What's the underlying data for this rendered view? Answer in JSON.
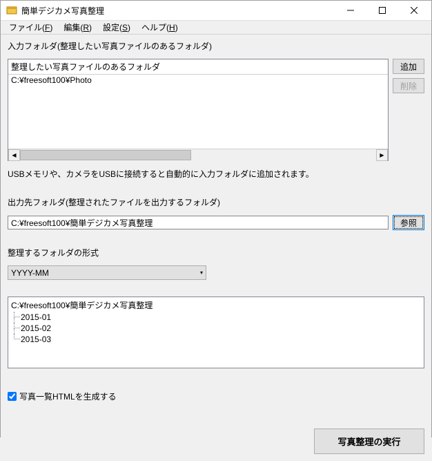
{
  "window": {
    "title": "簡単デジカメ写真整理"
  },
  "menubar": {
    "file": "ファイル(F)",
    "edit": "編集(R)",
    "settings": "設定(S)",
    "help": "ヘルプ(H)"
  },
  "input_section": {
    "label": "入力フォルダ(整理したい写真ファイルのあるフォルダ)",
    "header": "整理したい写真ファイルのあるフォルダ",
    "rows": [
      "C:¥freesoft100¥Photo"
    ],
    "add_btn": "追加",
    "delete_btn": "削除",
    "hint": "USBメモリや、カメラをUSBに接続すると自動的に入力フォルダに追加されます。"
  },
  "output_section": {
    "label": "出力先フォルダ(整理されたファイルを出力するフォルダ)",
    "path": "C:¥freesoft100¥簡単デジカメ写真整理",
    "browse_btn": "参照"
  },
  "format_section": {
    "label": "整理するフォルダの形式",
    "selected": "YYYY-MM"
  },
  "tree": {
    "root": "C:¥freesoft100¥簡単デジカメ写真整理",
    "children": [
      "2015-01",
      "2015-02",
      "2015-03"
    ]
  },
  "options": {
    "generate_html": "写真一覧HTMLを生成する",
    "generate_html_checked": true
  },
  "footer": {
    "execute": "写真整理の実行"
  }
}
